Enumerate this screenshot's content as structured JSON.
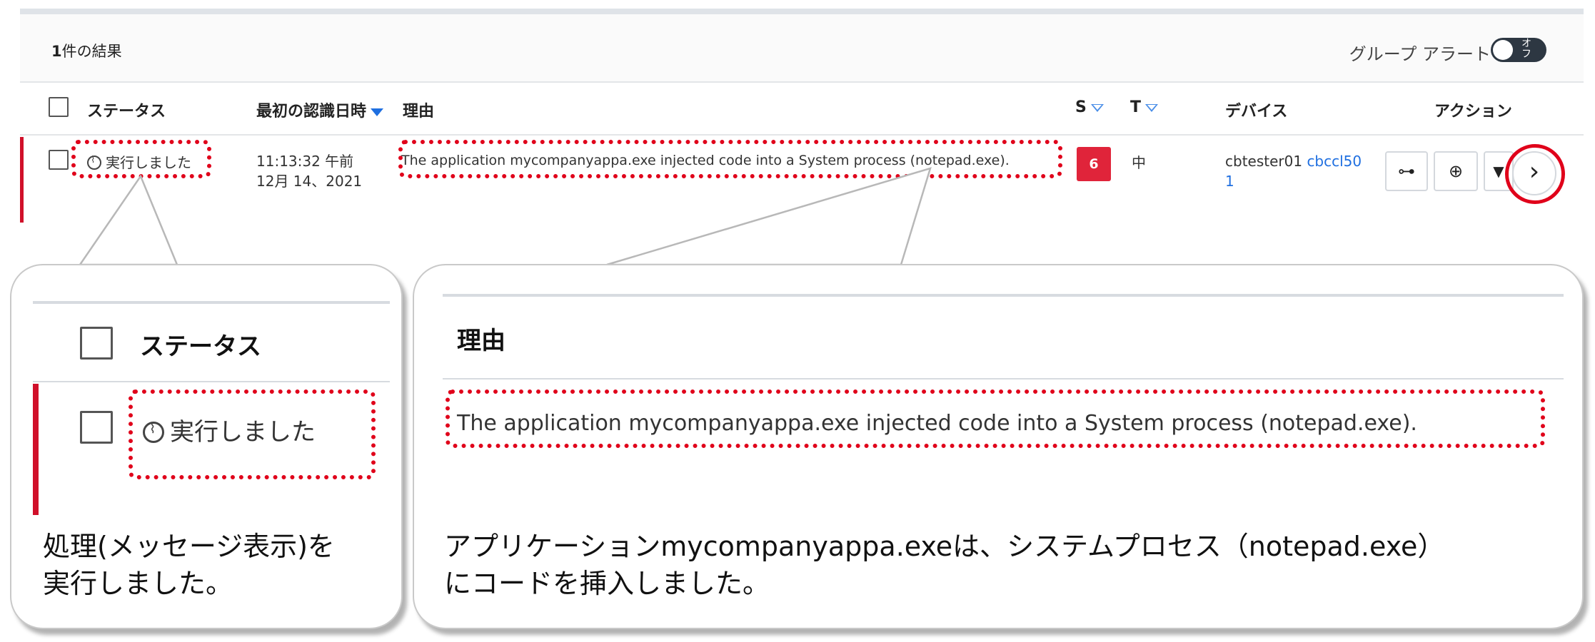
{
  "results": {
    "count": "1",
    "suffix": "件の結果"
  },
  "group_alert": {
    "label": "グループ アラート",
    "toggle_text": "オフ"
  },
  "columns": {
    "status": "ステータス",
    "first_seen": "最初の認識日時",
    "reason": "理由",
    "severity": "S",
    "threat": "T",
    "device": "デバイス",
    "actions": "アクション"
  },
  "row": {
    "status": "実行しました",
    "time": "11:13:32 午前",
    "date": "12月 14、2021",
    "reason": "The application mycompanyappa.exe injected code into a System process (notepad.exe).",
    "severity": "6",
    "threat": "中",
    "device_user": "cbtester01",
    "device_name_1": "cbccl50",
    "device_name_2": "1"
  },
  "callout_status": {
    "header": "ステータス",
    "status": "実行しました",
    "caption_line1": "処理(メッセージ表示)を",
    "caption_line2": "実行しました。"
  },
  "callout_reason": {
    "header": "理由",
    "reason": "The application mycompanyappa.exe injected code into a System process (notepad.exe).",
    "caption_line1": "アプリケーションmycompanyappa.exeは、システムプロセス（notepad.exe）",
    "caption_line2": "にコードを挿入しました。"
  },
  "icons": [
    "status-running-icon",
    "sort-desc-icon",
    "filter-icon",
    "process-tree-icon",
    "investigate-icon",
    "dropdown-icon",
    "chevron-right-icon"
  ],
  "colors": {
    "severity_bg": "#e0243a",
    "highlight": "#e0001a",
    "link": "#1f6fe0",
    "row_accent": "#d0102a"
  }
}
